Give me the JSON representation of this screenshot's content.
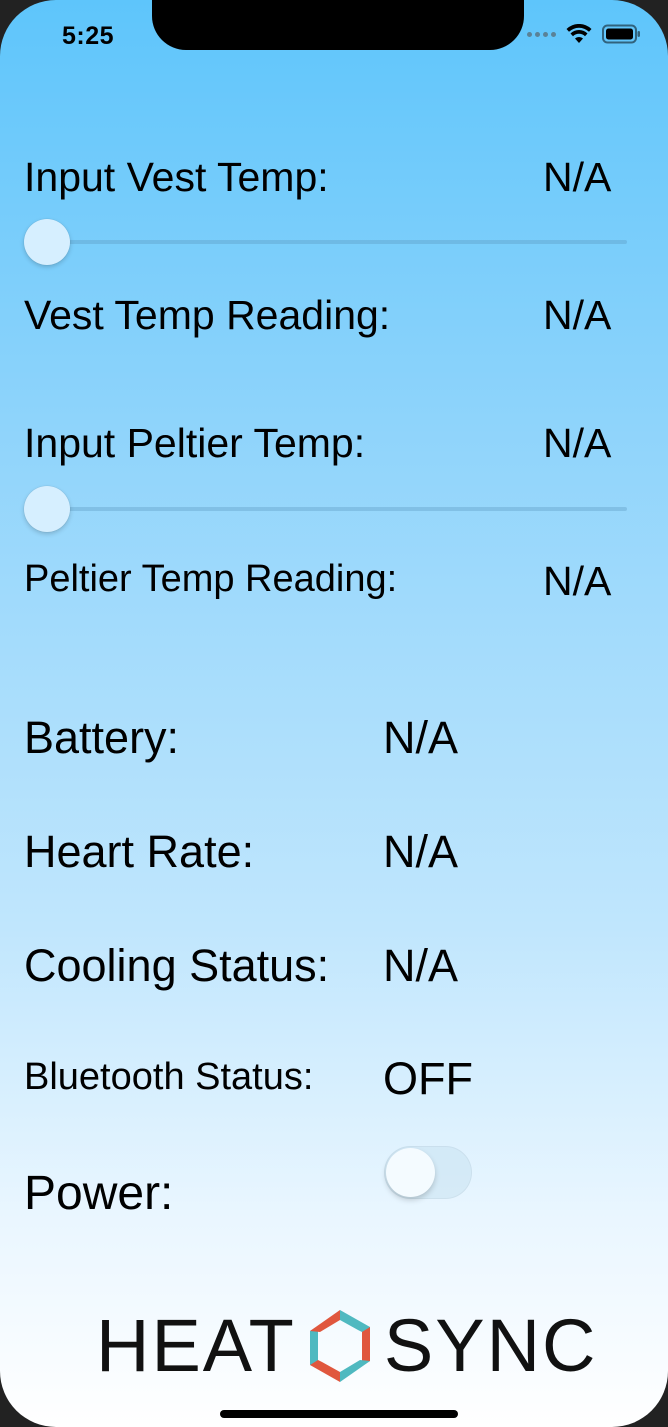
{
  "status_bar": {
    "time": "5:25"
  },
  "readings": {
    "input_vest_temp": {
      "label": "Input Vest Temp:",
      "value": "N/A"
    },
    "vest_temp_reading": {
      "label": "Vest Temp Reading:",
      "value": "N/A"
    },
    "input_peltier_temp": {
      "label": "Input Peltier Temp:",
      "value": "N/A"
    },
    "peltier_temp_reading": {
      "label": "Peltier Temp Reading:",
      "value": "N/A"
    }
  },
  "sliders": {
    "vest_temp_level": 0,
    "peltier_temp_level": 0
  },
  "status": {
    "battery": {
      "label": "Battery:",
      "value": "N/A"
    },
    "heart_rate": {
      "label": "Heart Rate:",
      "value": "N/A"
    },
    "cooling_status": {
      "label": "Cooling Status:",
      "value": "N/A"
    },
    "bluetooth_status": {
      "label": "Bluetooth Status:",
      "value": "OFF"
    },
    "power": {
      "label": "Power:",
      "on": false
    }
  },
  "logo": {
    "left": "HEAT",
    "right": "SYNC",
    "colors": {
      "teal": "#4fb9c0",
      "red": "#e0573e"
    }
  },
  "icons": {
    "signal": "cellular-signal-icon",
    "wifi": "wifi-icon",
    "battery": "battery-icon"
  }
}
